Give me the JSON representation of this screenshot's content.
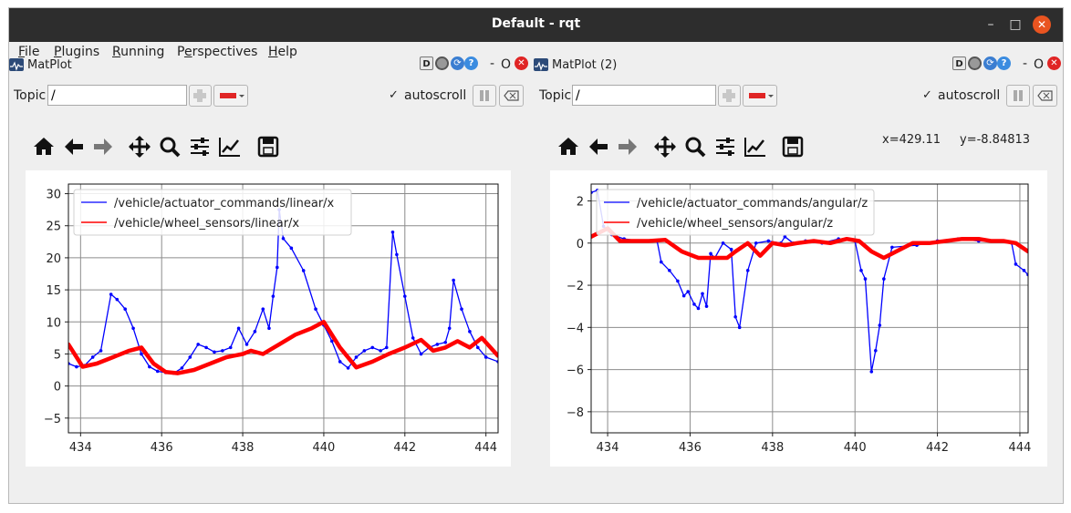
{
  "window": {
    "title": "Default - rqt",
    "min_glyph": "–",
    "max_glyph": "□",
    "close_glyph": "✕"
  },
  "menu": [
    {
      "pre": "",
      "key": "F",
      "post": "ile"
    },
    {
      "pre": "",
      "key": "P",
      "post": "lugins"
    },
    {
      "pre": "",
      "key": "R",
      "post": "unning"
    },
    {
      "pre": "P",
      "key": "e",
      "post": "rspectives"
    },
    {
      "pre": "",
      "key": "H",
      "post": "elp"
    }
  ],
  "dock_controls": {
    "d_label": "D",
    "help_label": "?",
    "minus": "-",
    "float": "O",
    "close": "✕"
  },
  "panels": [
    {
      "title": "MatPlot",
      "topic_label": "Topic",
      "topic_value": "/",
      "autoscroll_label": "autoscroll",
      "autoscroll_checked": "✓",
      "coords": {
        "x": "",
        "y": ""
      }
    },
    {
      "title": "MatPlot (2)",
      "topic_label": "Topic",
      "topic_value": "/",
      "autoscroll_label": "autoscroll",
      "autoscroll_checked": "✓",
      "coords": {
        "x": "x=429.11",
        "y": "y=-8.84813"
      }
    }
  ],
  "colors": {
    "accent_close": "#e95420",
    "series_commands": "#0000ff",
    "series_sensors": "#ff0000",
    "grid": "#8c8c8c"
  },
  "chart_data": [
    {
      "type": "line",
      "xlim": [
        433.7,
        444.3
      ],
      "ylim": [
        -7.3,
        31.5
      ],
      "xticks": [
        434,
        436,
        438,
        440,
        442,
        444
      ],
      "yticks": [
        -5,
        0,
        5,
        10,
        15,
        20,
        25,
        30
      ],
      "grid": true,
      "legend_position": "top-left",
      "series": [
        {
          "name": "/vehicle/actuator_commands/linear/x",
          "color": "#0000ff",
          "style": "thin-line-dots",
          "x": [
            433.7,
            433.9,
            434.1,
            434.3,
            434.5,
            434.75,
            434.9,
            435.1,
            435.3,
            435.5,
            435.7,
            435.9,
            436.1,
            436.3,
            436.5,
            436.7,
            436.9,
            437.1,
            437.3,
            437.5,
            437.7,
            437.9,
            438.1,
            438.3,
            438.5,
            438.65,
            438.75,
            438.85,
            438.9,
            439.0,
            439.2,
            439.5,
            439.8,
            440.0,
            440.2,
            440.4,
            440.6,
            440.8,
            441.0,
            441.2,
            441.4,
            441.55,
            441.7,
            441.8,
            442.0,
            442.2,
            442.4,
            442.6,
            442.8,
            443.0,
            443.1,
            443.2,
            443.4,
            443.6,
            443.8,
            444.0,
            444.3
          ],
          "y": [
            3.5,
            3.0,
            3.2,
            4.5,
            5.5,
            14.3,
            13.5,
            12.0,
            9.0,
            5.0,
            3.0,
            2.3,
            2.1,
            2.0,
            2.8,
            4.5,
            6.5,
            6.0,
            5.3,
            5.5,
            6.0,
            9.0,
            6.5,
            8.5,
            12.0,
            9.0,
            14.0,
            18.5,
            27.5,
            23.0,
            21.5,
            18.0,
            12.0,
            9.5,
            7.0,
            3.8,
            2.8,
            4.5,
            5.5,
            6.0,
            5.5,
            6.0,
            24.0,
            20.5,
            14.0,
            7.5,
            5.0,
            6.0,
            6.5,
            6.8,
            9.0,
            16.5,
            12.0,
            8.5,
            6.0,
            4.5,
            3.8
          ]
        },
        {
          "name": "/vehicle/wheel_sensors/linear/x",
          "color": "#ff0000",
          "style": "thick-line",
          "x": [
            433.7,
            434.05,
            434.4,
            434.8,
            435.2,
            435.5,
            435.8,
            436.1,
            436.4,
            436.8,
            437.2,
            437.6,
            438.0,
            438.2,
            438.5,
            438.9,
            439.3,
            439.7,
            440.0,
            440.4,
            440.8,
            441.2,
            441.6,
            442.0,
            442.4,
            442.7,
            443.0,
            443.3,
            443.6,
            443.9,
            444.3
          ],
          "y": [
            6.5,
            3.0,
            3.5,
            4.5,
            5.5,
            6.0,
            3.5,
            2.2,
            2.0,
            2.5,
            3.5,
            4.5,
            5.0,
            5.5,
            5.0,
            6.5,
            8.0,
            9.0,
            10.0,
            6.0,
            2.9,
            3.8,
            5.0,
            6.0,
            7.2,
            5.5,
            6.0,
            7.0,
            6.0,
            7.5,
            4.7
          ]
        }
      ]
    },
    {
      "type": "line",
      "xlim": [
        433.6,
        444.2
      ],
      "ylim": [
        -9.0,
        2.8
      ],
      "xticks": [
        434,
        436,
        438,
        440,
        442,
        444
      ],
      "yticks": [
        -8,
        -6,
        -4,
        -2,
        0,
        2
      ],
      "grid": true,
      "legend_position": "top-left",
      "series": [
        {
          "name": "/vehicle/actuator_commands/angular/z",
          "color": "#0000ff",
          "style": "thin-line-dots",
          "x": [
            433.6,
            433.75,
            433.9,
            434.1,
            434.4,
            434.8,
            435.2,
            435.3,
            435.5,
            435.7,
            435.85,
            435.95,
            436.1,
            436.2,
            436.3,
            436.4,
            436.5,
            436.6,
            436.8,
            437.0,
            437.1,
            437.2,
            437.4,
            437.6,
            437.9,
            438.2,
            438.3,
            438.5,
            438.8,
            439.2,
            439.6,
            440.0,
            440.15,
            440.25,
            440.4,
            440.5,
            440.6,
            440.7,
            440.9,
            441.5,
            442.0,
            442.5,
            443.0,
            443.5,
            443.8,
            443.9,
            444.1,
            444.2
          ],
          "y": [
            2.4,
            2.5,
            0.8,
            0.4,
            0.2,
            0.1,
            0.1,
            -0.9,
            -1.3,
            -1.8,
            -2.5,
            -2.3,
            -2.9,
            -3.1,
            -2.4,
            -3.0,
            -0.5,
            -0.7,
            0.0,
            -0.3,
            -3.5,
            -4.0,
            -1.3,
            0.0,
            0.1,
            0.0,
            0.3,
            0.0,
            0.1,
            0.0,
            0.2,
            0.1,
            -1.3,
            -1.7,
            -6.1,
            -5.1,
            -3.9,
            -1.7,
            -0.2,
            -0.1,
            0.1,
            0.2,
            0.1,
            0.1,
            0.0,
            -1.0,
            -1.3,
            -1.5
          ]
        },
        {
          "name": "/vehicle/wheel_sensors/angular/z",
          "color": "#ff0000",
          "style": "thick-line",
          "x": [
            433.6,
            434.0,
            434.3,
            434.6,
            435.0,
            435.4,
            435.8,
            436.2,
            436.6,
            436.9,
            437.1,
            437.4,
            437.7,
            438.0,
            438.3,
            438.6,
            439.0,
            439.4,
            439.8,
            440.1,
            440.4,
            440.7,
            441.0,
            441.4,
            441.8,
            442.2,
            442.6,
            443.0,
            443.3,
            443.6,
            443.9,
            444.2
          ],
          "y": [
            0.3,
            0.7,
            0.1,
            0.1,
            0.1,
            0.15,
            -0.4,
            -0.7,
            -0.7,
            -0.7,
            -0.4,
            0.0,
            -0.6,
            0.0,
            -0.1,
            0.0,
            0.1,
            0.0,
            0.2,
            0.1,
            -0.4,
            -0.7,
            -0.4,
            0.0,
            0.0,
            0.1,
            0.2,
            0.2,
            0.1,
            0.1,
            0.0,
            -0.4
          ]
        }
      ]
    }
  ]
}
